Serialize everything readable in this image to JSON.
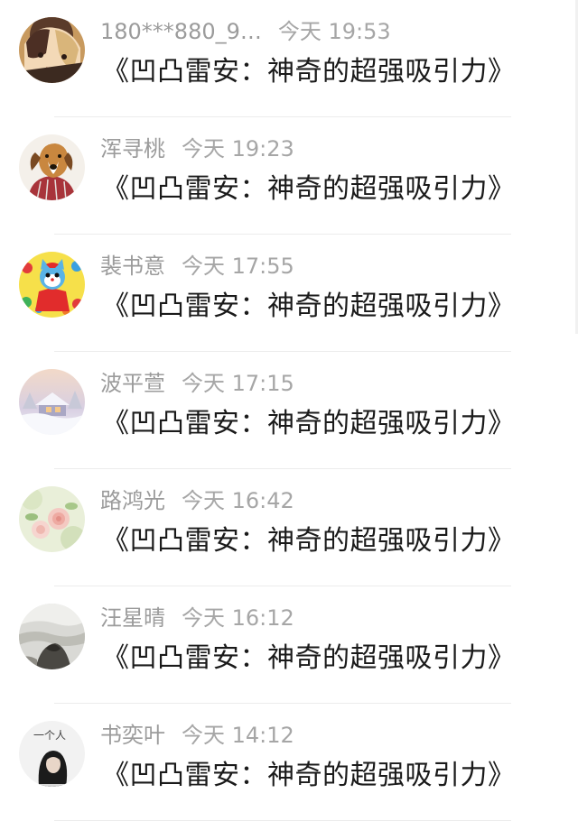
{
  "comments": [
    {
      "name": "180***880_9…",
      "time": "今天 19:53",
      "text": "《凹凸雷安：神奇的超强吸引力》",
      "avatar": "anime-couple-avatar"
    },
    {
      "name": "浑寻桃",
      "time": "今天 19:23",
      "text": "《凹凸雷安：神奇的超强吸引力》",
      "avatar": "dog-avatar"
    },
    {
      "name": "裴书意",
      "time": "今天 17:55",
      "text": "《凹凸雷安：神奇的超强吸引力》",
      "avatar": "cartoon-cat-avatar"
    },
    {
      "name": "波平萱",
      "time": "今天 17:15",
      "text": "《凹凸雷安：神奇的超强吸引力》",
      "avatar": "snow-house-avatar"
    },
    {
      "name": "路鸿光",
      "time": "今天 16:42",
      "text": "《凹凸雷安：神奇的超强吸引力》",
      "avatar": "roses-avatar"
    },
    {
      "name": "汪星晴",
      "time": "今天 16:12",
      "text": "《凹凸雷安：神奇的超强吸引力》",
      "avatar": "sea-rocks-avatar"
    },
    {
      "name": "书奕叶",
      "time": "今天 14:12",
      "text": "《凹凸雷安：神奇的超强吸引力》",
      "avatar": "girl-portrait-avatar"
    }
  ],
  "avatar_badges": {
    "girl_portrait": "一个人"
  },
  "colors": {
    "name": "#9b9b9b",
    "time": "#a6a6a6",
    "text": "#1a1a1a",
    "divider": "#ececec"
  }
}
